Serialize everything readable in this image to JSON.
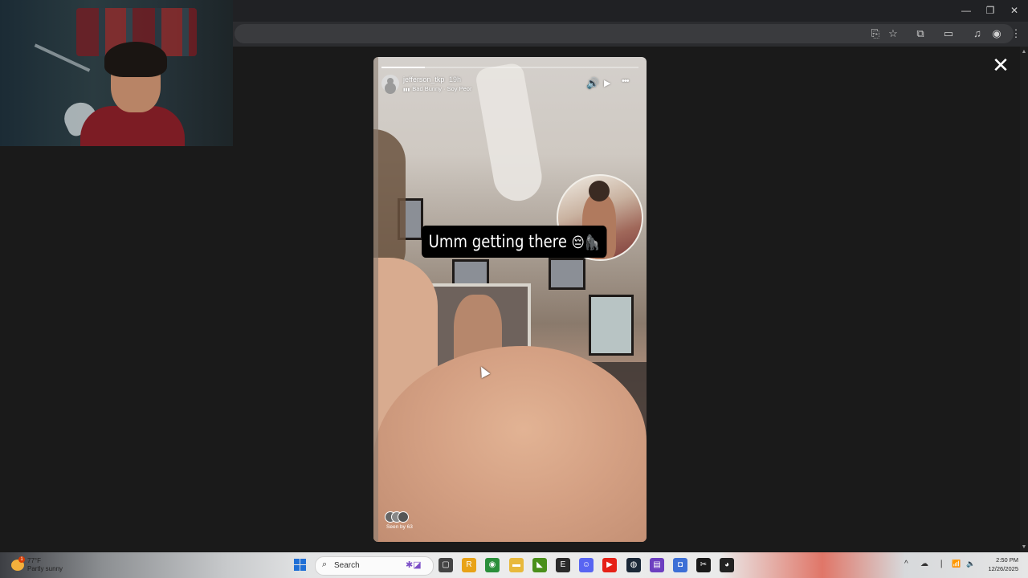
{
  "window": {
    "minimize_glyph": "—",
    "maximize_glyph": "❐",
    "close_glyph": "✕"
  },
  "toolbar": {
    "icons": [
      "install-app-icon",
      "bookmark-star-icon",
      "extensions-icon",
      "sidepanel-icon",
      "media-controls-icon",
      "profile-icon",
      "menu-icon"
    ],
    "glyphs": [
      "⎘",
      "☆",
      "⧉",
      "▭",
      "♫",
      "◉",
      "⋮"
    ]
  },
  "story": {
    "username": "jefferson_tkp",
    "time_ago": "19h",
    "music_icon": "▮▮▮",
    "music": "Bad Bunny · Soy Peor",
    "progress": 0.17,
    "mute_glyph": "🔊",
    "play_glyph": "▶",
    "more_glyph": "•••",
    "caption": "Umm getting there",
    "caption_emoji": "😔🦍",
    "seen_by": "Seen by 63"
  },
  "viewer": {
    "close_glyph": "✕"
  },
  "taskbar": {
    "weather_temp": "77°F",
    "weather_condition": "Partly sunny",
    "notification_count": "1",
    "search_label": "Search",
    "search_glyph": "⌕",
    "apps": [
      {
        "name": "task-view-icon",
        "glyph": "▢",
        "color": "#444444"
      },
      {
        "name": "rockstar-icon",
        "glyph": "R",
        "color": "#e8a317"
      },
      {
        "name": "chrome-icon",
        "glyph": "◉",
        "color": "#2a8f3a"
      },
      {
        "name": "file-explorer-icon",
        "glyph": "▬",
        "color": "#e8b93c"
      },
      {
        "name": "nvidia-icon",
        "glyph": "◣",
        "color": "#4a8f1a"
      },
      {
        "name": "epic-games-icon",
        "glyph": "E",
        "color": "#2b2b2b"
      },
      {
        "name": "discord-icon",
        "glyph": "☺",
        "color": "#5865f2"
      },
      {
        "name": "youtube-icon",
        "glyph": "▶",
        "color": "#e62117"
      },
      {
        "name": "steam-icon",
        "glyph": "◍",
        "color": "#1b2838"
      },
      {
        "name": "game-launcher-icon",
        "glyph": "▤",
        "color": "#6d3fc0"
      },
      {
        "name": "app-blue-icon",
        "glyph": "◘",
        "color": "#3d6fd6"
      },
      {
        "name": "capcut-icon",
        "glyph": "✂",
        "color": "#1a1a1a"
      },
      {
        "name": "obs-icon",
        "glyph": "◕",
        "color": "#222222"
      }
    ],
    "tray": [
      "^",
      "☁",
      "❘",
      "📶",
      "🔈"
    ],
    "time": "2:50 PM",
    "date": "12/26/2025"
  }
}
